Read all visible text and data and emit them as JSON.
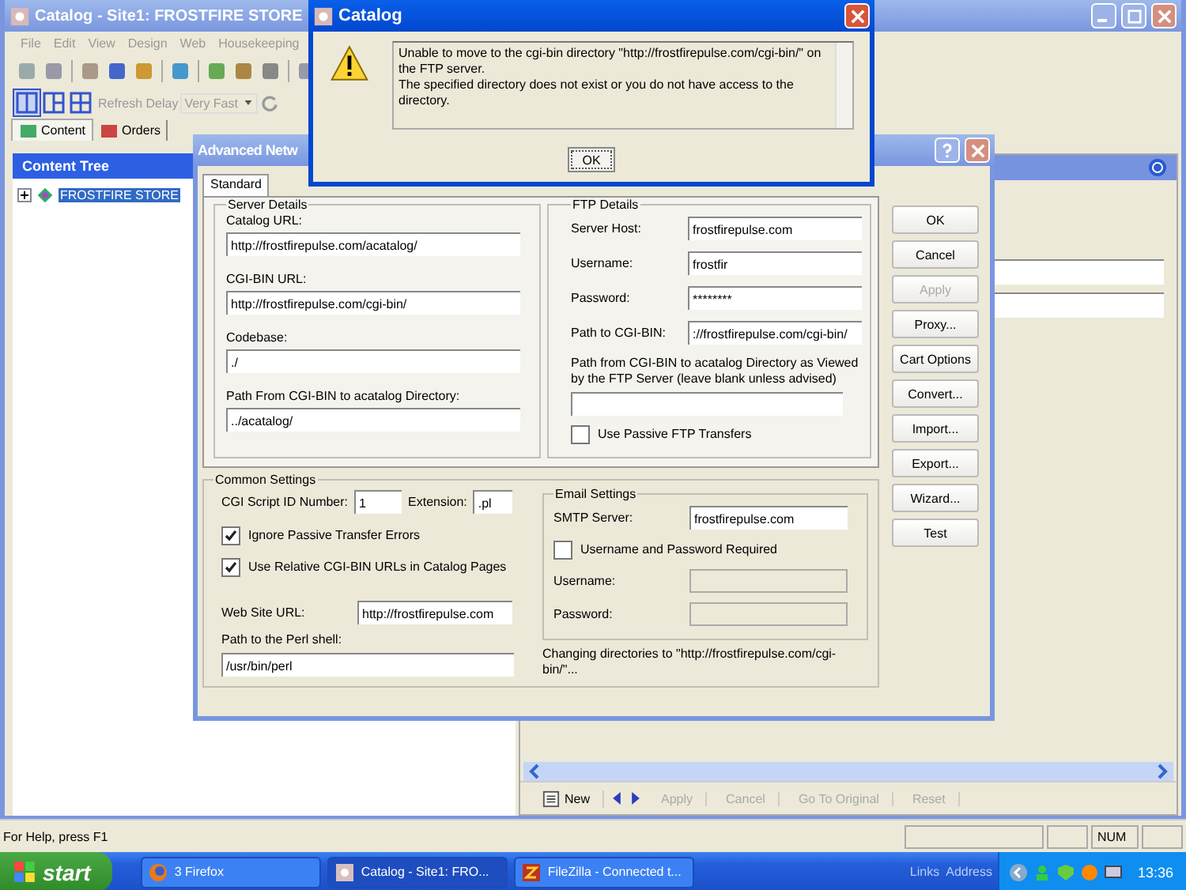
{
  "main_window": {
    "title": "Catalog - Site1: FROSTFIRE STORE",
    "menu": [
      "File",
      "Edit",
      "View",
      "Design",
      "Web",
      "Housekeeping"
    ],
    "refresh_label": "Refresh Delay",
    "refresh_value": "Very Fast",
    "tabs": [
      {
        "label": "Content",
        "selected": true
      },
      {
        "label": "Orders",
        "selected": false
      }
    ],
    "content_tree": {
      "title": "Content Tree",
      "items": [
        {
          "label": "FROSTFIRE STORE",
          "selected": true,
          "expanded": false
        }
      ]
    },
    "bottom_toolbar": [
      {
        "label": "New",
        "disabled": false
      },
      {
        "label": "Apply",
        "disabled": true
      },
      {
        "label": "Cancel",
        "disabled": true
      },
      {
        "label": "Go To Original",
        "disabled": true
      },
      {
        "label": "Reset",
        "disabled": true
      }
    ]
  },
  "advanced_dialog": {
    "title": "Advanced Netw",
    "tabs": [
      {
        "label": "Standard",
        "selected": true
      }
    ],
    "server_details": {
      "title": "Server Details",
      "fields": [
        {
          "label": "Catalog URL:",
          "value": "http://frostfirepulse.com/acatalog/"
        },
        {
          "label": "CGI-BIN URL:",
          "value": "http://frostfirepulse.com/cgi-bin/"
        },
        {
          "label": "Codebase:",
          "value": "./"
        },
        {
          "label": "Path From CGI-BIN to acatalog Directory:",
          "value": "../acatalog/"
        }
      ]
    },
    "ftp_details": {
      "title": "FTP Details",
      "fields": [
        {
          "label": "Server Host:",
          "value": "frostfirepulse.com"
        },
        {
          "label": "Username:",
          "value": "frostfir"
        },
        {
          "label": "Password:",
          "value": "********"
        },
        {
          "label": "Path to CGI-BIN:",
          "value": "://frostfirepulse.com/cgi-bin/"
        }
      ],
      "path_label": "Path from CGI-BIN to acatalog Directory as Viewed by the FTP Server (leave blank unless advised)",
      "passive": {
        "label": "Use Passive FTP Transfers",
        "checked": false
      }
    },
    "common_settings": {
      "title": "Common Settings",
      "script_id_label": "CGI Script ID Number:",
      "script_id": "1",
      "extension_label": "Extension:",
      "extension": ".pl",
      "checks": [
        {
          "label": "Ignore Passive Transfer Errors",
          "checked": true
        },
        {
          "label": "Use Relative CGI-BIN URLs in Catalog Pages",
          "checked": true
        }
      ],
      "website_label": "Web Site URL:",
      "website": "http://frostfirepulse.com",
      "perl_label": "Path to the Perl shell:",
      "perl": "/usr/bin/perl"
    },
    "email_settings": {
      "title": "Email Settings",
      "smtp_label": "SMTP Server:",
      "smtp": "frostfirepulse.com",
      "auth": {
        "label": "Username and Password Required",
        "checked": false
      },
      "fields": [
        {
          "label": "Username:",
          "disabled": true
        },
        {
          "label": "Password:",
          "disabled": true
        }
      ]
    },
    "status": "Changing directories to \"http://frostfirepulse.com/cgi-bin/\"...",
    "buttons": [
      {
        "label": "OK",
        "disabled": false
      },
      {
        "label": "Cancel",
        "disabled": false
      },
      {
        "label": "Apply",
        "disabled": true
      },
      {
        "label": "Proxy...",
        "disabled": false
      },
      {
        "label": "Cart Options",
        "disabled": false
      },
      {
        "label": "Convert...",
        "disabled": false
      },
      {
        "label": "Import...",
        "disabled": false
      },
      {
        "label": "Export...",
        "disabled": false
      },
      {
        "label": "Wizard...",
        "disabled": false
      },
      {
        "label": "Test",
        "disabled": false
      }
    ]
  },
  "message_box": {
    "title": "Catalog",
    "lines": [
      "Unable to move to the cgi-bin directory \"http://frostfirepulse.com/cgi-bin/\" on the FTP server.",
      "The specified directory does not exist or you do not have access to the directory."
    ],
    "button": "OK"
  },
  "status_bar": {
    "text": "For Help, press F1",
    "indicators": [
      "NUM"
    ]
  },
  "taskbar": {
    "start": "start",
    "tasks": [
      {
        "label": "3 Firefox",
        "kind": "firefox",
        "selected": false
      },
      {
        "label": "Catalog - Site1: FRO...",
        "kind": "catalog",
        "selected": true
      },
      {
        "label": "FileZilla - Connected t...",
        "kind": "filezilla",
        "selected": false
      }
    ],
    "links": "Links",
    "address": "Address",
    "clock": "13:36"
  }
}
